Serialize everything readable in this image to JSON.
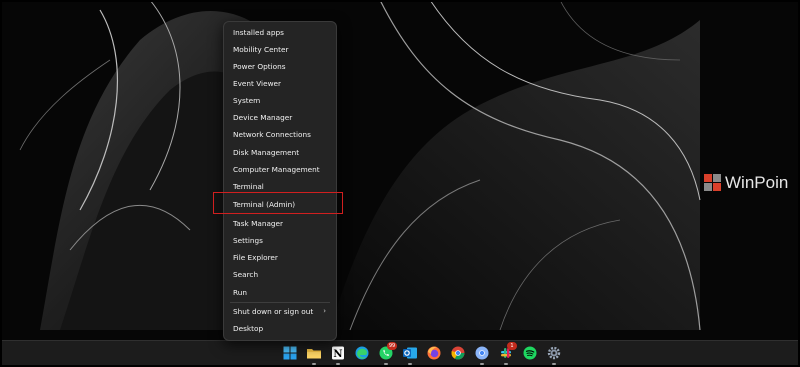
{
  "context_menu": {
    "items": [
      {
        "label": "Installed apps"
      },
      {
        "label": "Mobility Center"
      },
      {
        "label": "Power Options"
      },
      {
        "label": "Event Viewer"
      },
      {
        "label": "System"
      },
      {
        "label": "Device Manager"
      },
      {
        "label": "Network Connections"
      },
      {
        "label": "Disk Management"
      },
      {
        "label": "Computer Management"
      },
      {
        "label": "Terminal"
      },
      {
        "label": "Terminal (Admin)"
      },
      {
        "label": "Task Manager"
      },
      {
        "label": "Settings"
      },
      {
        "label": "File Explorer"
      },
      {
        "label": "Search"
      },
      {
        "label": "Run"
      },
      {
        "label": "Shut down or sign out"
      },
      {
        "label": "Desktop"
      }
    ],
    "highlighted_item": "Terminal (Admin)",
    "submenu_chevron": "›"
  },
  "watermark": {
    "text": "WinPoin"
  },
  "taskbar": {
    "icons": [
      {
        "name": "start-icon"
      },
      {
        "name": "file-explorer-icon"
      },
      {
        "name": "notion-icon",
        "glyph": "N"
      },
      {
        "name": "edge-icon"
      },
      {
        "name": "whatsapp-icon",
        "badge": "99"
      },
      {
        "name": "outlook-icon"
      },
      {
        "name": "firefox-icon"
      },
      {
        "name": "chrome-icon"
      },
      {
        "name": "chrome-profile-icon"
      },
      {
        "name": "slack-icon",
        "badge": "1"
      },
      {
        "name": "spotify-icon"
      },
      {
        "name": "settings-icon"
      }
    ]
  },
  "colors": {
    "menu_bg": "#242424",
    "highlight_border": "#d11f1f",
    "taskbar_bg": "#1c1c1c",
    "badge": "#c42b1c"
  }
}
